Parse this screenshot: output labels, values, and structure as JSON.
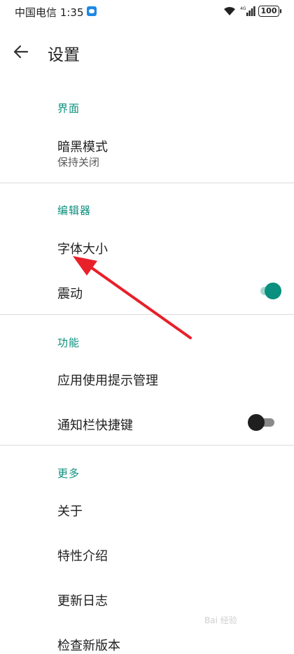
{
  "status_bar": {
    "carrier": "中国电信",
    "time": "1:35",
    "network": "4G",
    "battery": "100"
  },
  "toolbar": {
    "title": "设置",
    "back_icon": "arrow-left-icon"
  },
  "sections": [
    {
      "header": "界面",
      "items": [
        {
          "label": "暗黑模式",
          "sub": "保持关闭"
        }
      ]
    },
    {
      "header": "编辑器",
      "items": [
        {
          "label": "字体大小"
        },
        {
          "label": "震动",
          "toggle": "on"
        }
      ]
    },
    {
      "header": "功能",
      "items": [
        {
          "label": "应用使用提示管理"
        },
        {
          "label": "通知栏快捷键",
          "toggle": "off"
        }
      ]
    },
    {
      "header": "更多",
      "items": [
        {
          "label": "关于"
        },
        {
          "label": "特性介绍"
        },
        {
          "label": "更新日志"
        },
        {
          "label": "检查新版本"
        }
      ]
    }
  ],
  "colors": {
    "accent": "#0b8f7e",
    "toggle_off_thumb": "#1f1f1f",
    "toggle_off_track": "#8a8a8a",
    "annotation_arrow": "#e8202a"
  },
  "watermark": "Bai 经验"
}
